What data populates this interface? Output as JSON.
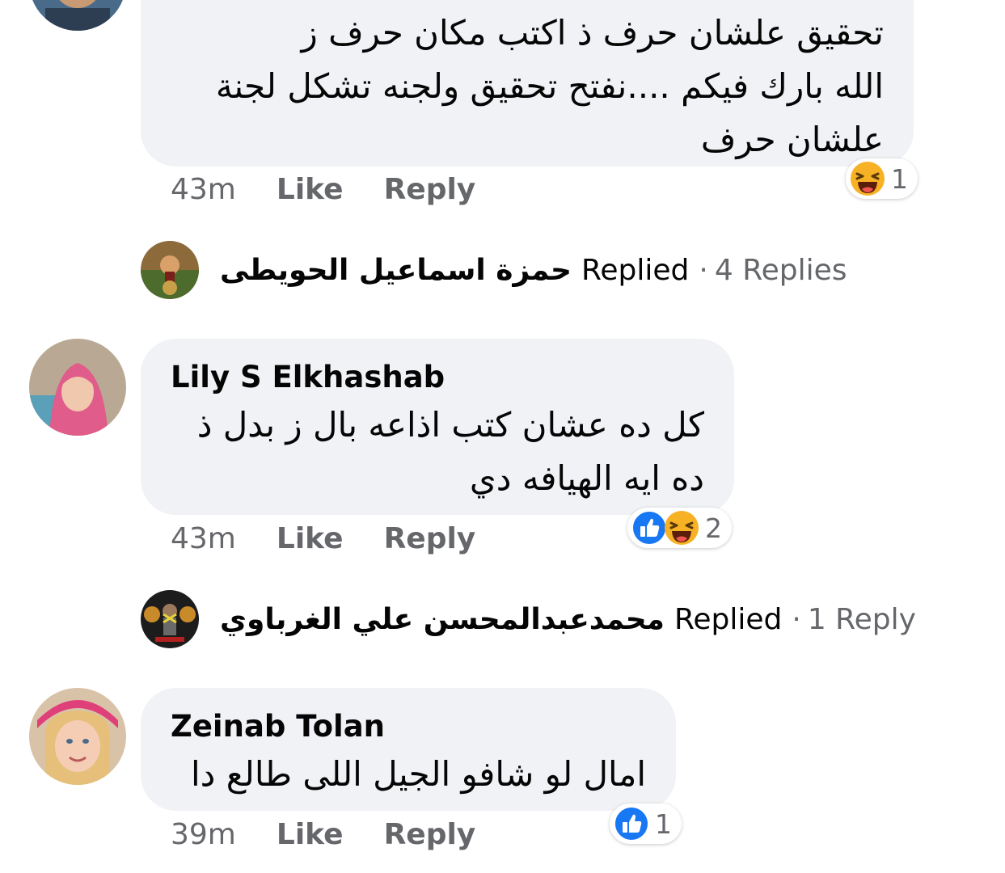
{
  "comments": [
    {
      "text_lines": [
        "تحقيق علشان حرف ذ اكتب مكان حرف ز",
        "الله بارك فيكم ....نفتح تحقيق ولجنه تشكل لجنة",
        "علشان حرف"
      ],
      "time": "43m",
      "like_label": "Like",
      "reply_label": "Reply",
      "reaction_count": "1",
      "reactions": [
        "haha-icon"
      ]
    },
    {
      "author": "Lily S Elkhashab",
      "text_lines": [
        "كل ده عشان كتب اذاعه بال ز بدل ذ",
        "ده ايه الهيافه دي"
      ],
      "time": "43m",
      "like_label": "Like",
      "reply_label": "Reply",
      "reaction_count": "2",
      "reactions": [
        "like-icon",
        "haha-icon"
      ]
    },
    {
      "author": "Zeinab Tolan",
      "text_lines": [
        "امال لو شافو الجيل اللى طالع دا"
      ],
      "time": "39m",
      "like_label": "Like",
      "reply_label": "Reply",
      "reaction_count": "1",
      "reactions": [
        "like-icon"
      ]
    }
  ],
  "reply_summaries": [
    {
      "name": "حمزة اسماعيل الحويطى",
      "replied_label": "Replied",
      "dot": "·",
      "count_label": "4 Replies"
    },
    {
      "name": "محمدعبدالمحسن علي الغرباوي",
      "replied_label": "Replied",
      "dot": "·",
      "count_label": "1 Reply"
    }
  ],
  "colors": {
    "bubble": "#f0f2f5",
    "meta_text": "#65676b",
    "like_blue": "#1877f2",
    "haha_yellow": "#f7b125"
  }
}
